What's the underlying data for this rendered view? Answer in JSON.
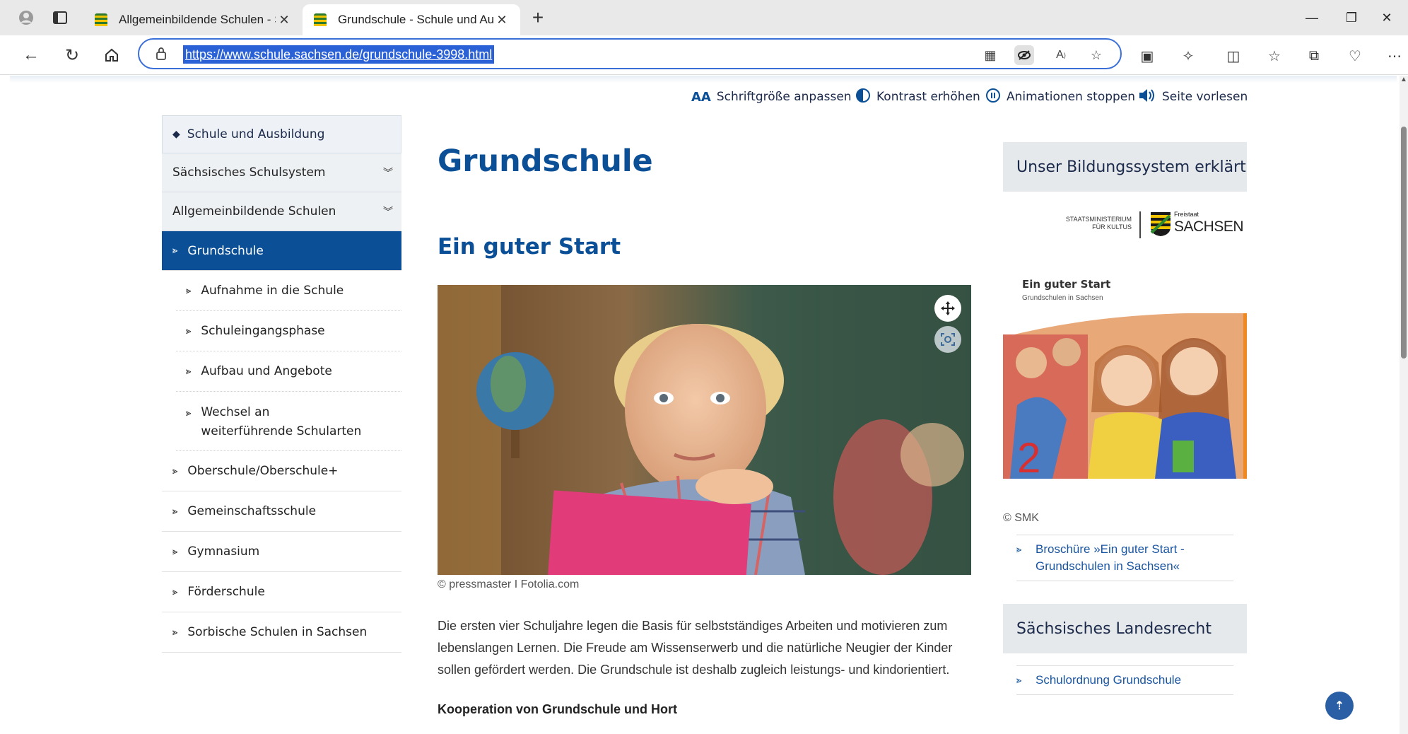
{
  "browser": {
    "tabs": [
      {
        "title": "Allgemeinbildende Schulen - Sch",
        "active": false
      },
      {
        "title": "Grundschule - Schule und Ausbil",
        "active": true
      }
    ],
    "url": "https://www.schule.sachsen.de/grundschule-3998.html",
    "icons": {
      "profile": "profile-icon",
      "workspaces": "tab-actions-icon",
      "new_tab": "plus-icon",
      "window_min": "minimize-icon",
      "window_restore": "restore-icon",
      "window_close": "close-icon"
    }
  },
  "accessibility_bar": {
    "font_size": "Schriftgröße anpassen",
    "contrast": "Kontrast erhöhen",
    "animations": "Animationen stoppen",
    "read_aloud": "Seite vorlesen"
  },
  "sidebar": {
    "heading": "Schule und Ausbildung",
    "items": [
      {
        "label": "Sächsisches Schulsystem"
      },
      {
        "label": "Allgemeinbildende Schulen"
      },
      {
        "label": "Grundschule"
      },
      {
        "label": "Aufnahme in die Schule"
      },
      {
        "label": "Schuleingangsphase"
      },
      {
        "label": "Aufbau und Angebote"
      },
      {
        "label": "Wechsel an weiterführende Schularten"
      },
      {
        "label": "Oberschule/Oberschule+"
      },
      {
        "label": "Gemeinschaftsschule"
      },
      {
        "label": "Gymnasium"
      },
      {
        "label": "Förderschule"
      },
      {
        "label": "Sorbische Schulen in Sachsen"
      }
    ]
  },
  "main": {
    "title": "Grundschule",
    "section_title": "Ein guter Start",
    "image_credit": "© pressmaster I Fotolia.com",
    "paragraph": "Die ersten vier Schuljahre legen die Basis für selbstständiges Arbeiten und motivieren zum lebenslangen Lernen. Die Freude am Wissenserwerb und die natürliche Neugier der Kinder sollen gefördert werden. Die Grundschule ist deshalb zugleich leistungs- und kindorientiert.",
    "subheading": "Kooperation von Grundschule und Hort"
  },
  "right": {
    "box1_title": "Unser Bildungssystem erklärt",
    "logo_line1": "STAATSMINISTERIUM",
    "logo_line2": "FÜR KULTUS",
    "logo_freistaat": "Freistaat",
    "logo_sachsen": "SACHSEN",
    "brochure_title": "Ein guter Start",
    "brochure_subtitle": "Grundschulen in Sachsen",
    "brochure_credit": "© SMK",
    "brochure_link": "Broschüre »Ein guter Start - Grundschulen in Sachsen«",
    "box2_title": "Sächsisches Landesrecht",
    "law_link": "Schulordnung Grundschule"
  },
  "colors": {
    "brand_blue": "#0b4f96",
    "link_blue": "#1a55a0",
    "sidebar_grey": "#eef1f4",
    "box_grey": "#e6e9ec"
  }
}
